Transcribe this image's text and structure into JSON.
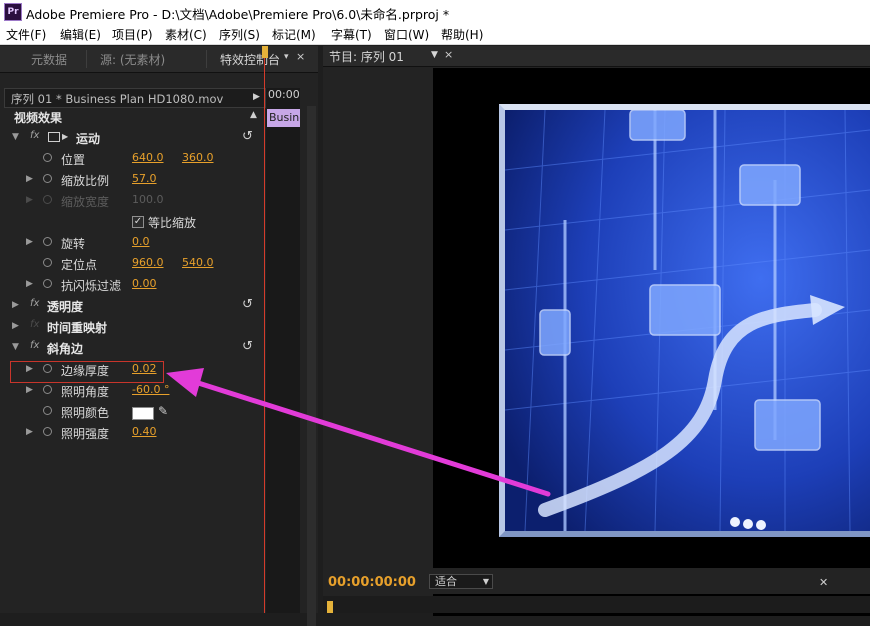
{
  "titlebar": {
    "app_icon_text": "Pr",
    "title": "Adobe Premiere Pro - D:\\文档\\Adobe\\Premiere Pro\\6.0\\未命名.prproj *"
  },
  "menu": [
    "文件(F)",
    "编辑(E)",
    "项目(P)",
    "素材(C)",
    "序列(S)",
    "标记(M)",
    "字幕(T)",
    "窗口(W)",
    "帮助(H)"
  ],
  "left_panel": {
    "tabs": [
      "元数据",
      "源: (无素材)",
      "特效控制台"
    ],
    "tab_close": "×",
    "sequence_header": "序列 01 * Business Plan HD1080.mov",
    "timeline_time": "00:00",
    "clip_label": "Busine",
    "section_title": "视频效果",
    "effects": {
      "motion": {
        "label": "运动",
        "position": {
          "label": "位置",
          "x": "640.0",
          "y": "360.0"
        },
        "scale": {
          "label": "缩放比例",
          "value": "57.0"
        },
        "scale_width": {
          "label": "缩放宽度",
          "value": "100.0"
        },
        "uniform_scale": {
          "label": "等比缩放",
          "checked": true
        },
        "rotation": {
          "label": "旋转",
          "value": "0.0"
        },
        "anchor": {
          "label": "定位点",
          "x": "960.0",
          "y": "540.0"
        },
        "anti_flicker": {
          "label": "抗闪烁过滤",
          "value": "0.00"
        }
      },
      "opacity": {
        "label": "透明度"
      },
      "time_remap": {
        "label": "时间重映射"
      },
      "bevel": {
        "label": "斜角边",
        "edge_thickness": {
          "label": "边缘厚度",
          "value": "0.02"
        },
        "light_angle": {
          "label": "照明角度",
          "value": "-60.0 °"
        },
        "light_color": {
          "label": "照明颜色",
          "value": "#ffffff"
        },
        "light_intensity": {
          "label": "照明强度",
          "value": "0.40"
        }
      }
    }
  },
  "program_monitor": {
    "tab_label": "节目: 序列 01",
    "tab_close": "×",
    "timecode": "00:00:00:00",
    "fit_label": "适合"
  },
  "colors": {
    "accent_value": "#e7a02b",
    "highlight_box": "#c8352b",
    "annotation_arrow": "#e23bd8"
  }
}
